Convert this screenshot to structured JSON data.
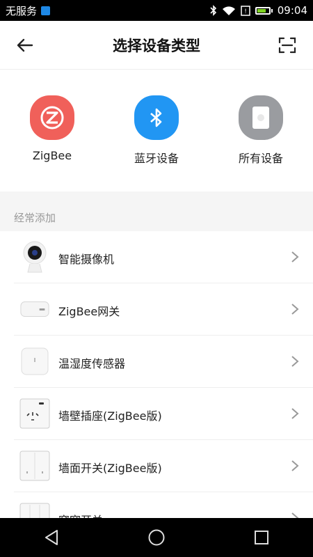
{
  "status_bar": {
    "carrier": "无服务",
    "time": "09:04"
  },
  "header": {
    "title": "选择设备类型"
  },
  "categories": [
    {
      "label": "ZigBee",
      "icon": "zigbee-icon",
      "color": "#f0605a"
    },
    {
      "label": "蓝牙设备",
      "icon": "bluetooth-icon",
      "color": "#2196f3"
    },
    {
      "label": "所有设备",
      "icon": "device-icon",
      "color": "#9a9ca0"
    }
  ],
  "section": {
    "title": "经常添加"
  },
  "items": [
    {
      "label": "智能摄像机",
      "icon": "camera-icon"
    },
    {
      "label": "ZigBee网关",
      "icon": "gateway-icon"
    },
    {
      "label": "温湿度传感器",
      "icon": "sensor-icon"
    },
    {
      "label": "墙壁插座(ZigBee版)",
      "icon": "wall-socket-icon"
    },
    {
      "label": "墙面开关(ZigBee版)",
      "icon": "wall-switch-icon"
    },
    {
      "label": "窗帘开关",
      "icon": "curtain-switch-icon"
    }
  ]
}
